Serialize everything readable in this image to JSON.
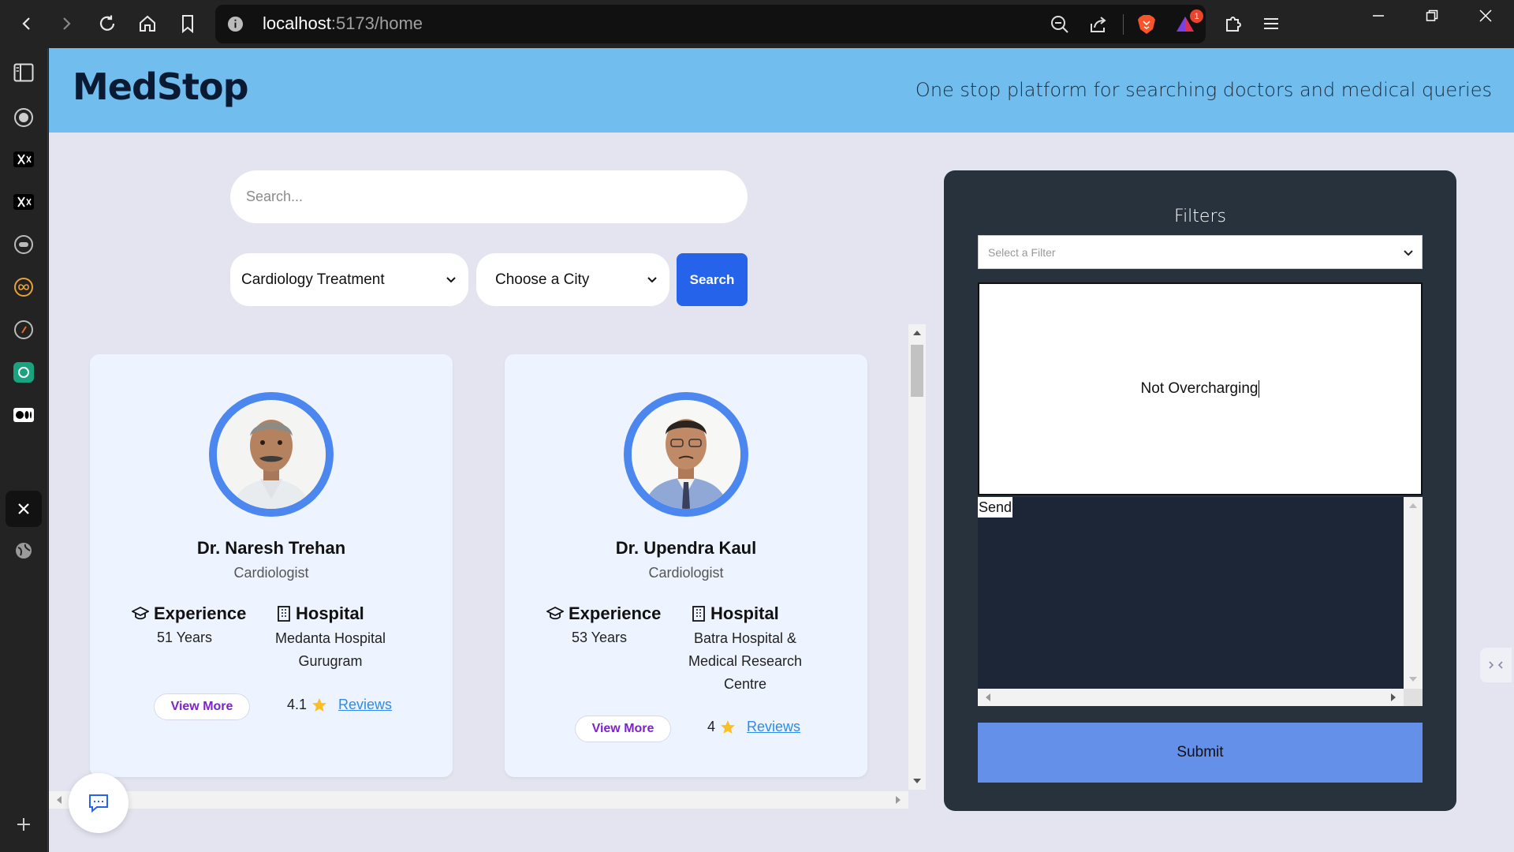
{
  "browser": {
    "url_host": "localhost",
    "url_rest": ":5173/home",
    "notification_count": "1"
  },
  "header": {
    "logo": "MedStop",
    "tagline": "One stop platform for searching doctors and medical queries"
  },
  "search": {
    "placeholder": "Search...",
    "treatment_selected": "Cardiology Treatment",
    "city_selected": "Choose a City",
    "button_label": "Search"
  },
  "doctors": [
    {
      "name": "Dr. Naresh Trehan",
      "specialty": "Cardiologist",
      "experience_label": "Experience",
      "experience": "51 Years",
      "hospital_label": "Hospital",
      "hospital_line1": "Medanta Hospital",
      "hospital_line2": "Gurugram",
      "hospital_line3": "",
      "view_more": "View More",
      "rating": "4.1",
      "reviews": "Reviews"
    },
    {
      "name": "Dr. Upendra Kaul",
      "specialty": "Cardiologist",
      "experience_label": "Experience",
      "experience": "53 Years",
      "hospital_label": "Hospital",
      "hospital_line1": "Batra Hospital &",
      "hospital_line2": "Medical Research",
      "hospital_line3": "Centre",
      "view_more": "View More",
      "rating": "4",
      "reviews": "Reviews"
    }
  ],
  "filters": {
    "title": "Filters",
    "select_placeholder": "Select a Filter",
    "textbox_value": "Not Overcharging",
    "send_label": "Send",
    "submit_label": "Submit"
  },
  "colors": {
    "header_bg": "#70bdee",
    "page_bg": "#e3e4ef",
    "panel_bg": "#27323d",
    "primary_button": "#2563eb",
    "submit_button": "#6490ea",
    "avatar_ring": "#4c86ef",
    "link": "#2a8bf2",
    "view_more_text": "#7e22ce"
  }
}
